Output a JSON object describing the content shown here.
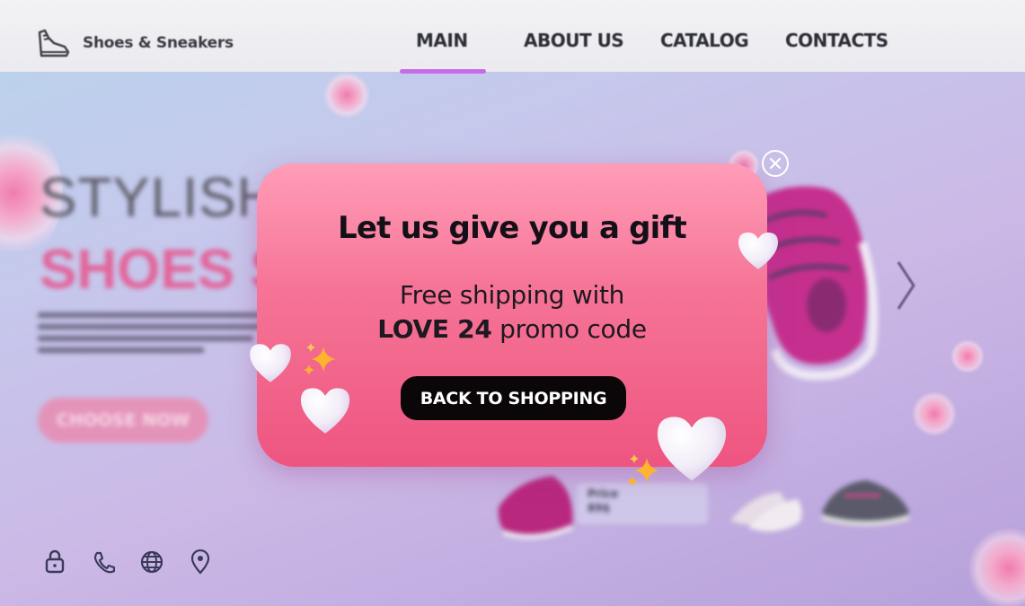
{
  "brand": {
    "name": "Shoes & Sneakers",
    "logo_icon": "shoe-logo-icon"
  },
  "nav": {
    "items": [
      {
        "label": "MAIN",
        "active": true
      },
      {
        "label": "ABOUT US",
        "active": false
      },
      {
        "label": "CATALOG",
        "active": false
      },
      {
        "label": "CONTACTS",
        "active": false
      }
    ]
  },
  "hero": {
    "title_line1": "STYLISH",
    "title_line2": "SHOES S",
    "cta_label": "CHOOSE NOW"
  },
  "product_card": {
    "price_label": "Price",
    "price_value": "89$"
  },
  "footer": {
    "icons": [
      "lock-icon",
      "phone-icon",
      "globe-icon",
      "location-pin-icon"
    ]
  },
  "popup": {
    "title": "Let us give you a gift",
    "line1": "Free shipping with",
    "promo_code": "LOVE 24",
    "line2_suffix": " promo code",
    "button_label": "BACK TO SHOPPING",
    "close_icon": "close-icon"
  },
  "colors": {
    "popup_top": "#ff9db8",
    "popup_bottom": "#ee5580",
    "button_bg": "#0b0709",
    "nav_accent": "#c86de8",
    "hero_pink": "#e2649a"
  }
}
